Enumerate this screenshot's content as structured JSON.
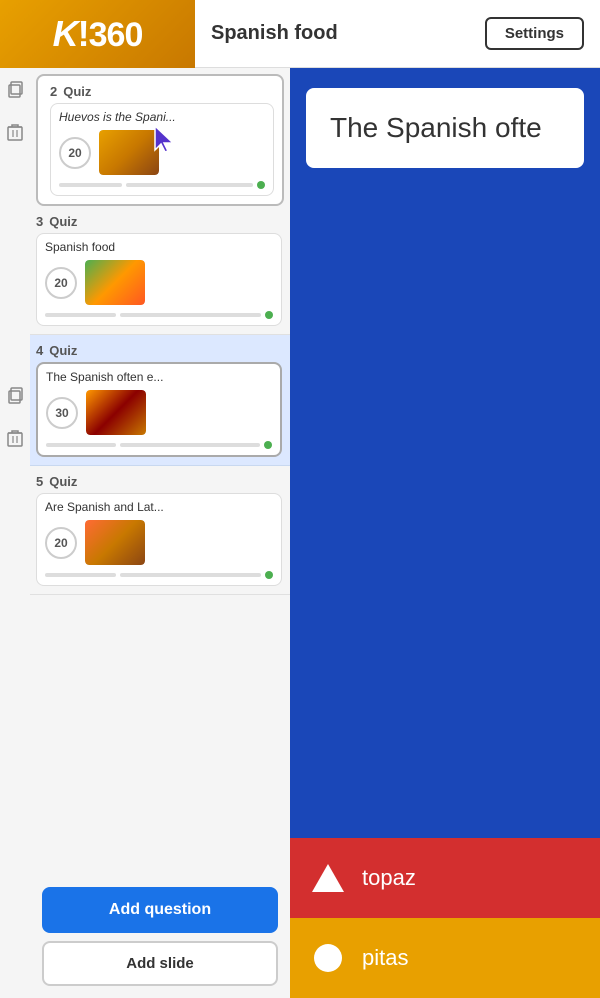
{
  "header": {
    "logo": "K!360",
    "title": "Spanish food",
    "settings_label": "Settings"
  },
  "sidebar": {
    "items": [
      {
        "num": "2",
        "type": "Quiz",
        "title": "Huevos is the Spani...",
        "points": "20",
        "bars": true,
        "dot": true,
        "food_type": "1",
        "state": "selected"
      },
      {
        "num": "3",
        "type": "Quiz",
        "title": "Spanish food",
        "points": "20",
        "bars": true,
        "dot": true,
        "food_type": "2",
        "state": "normal"
      },
      {
        "num": "4",
        "type": "Quiz",
        "title": "The Spanish often e...",
        "points": "30",
        "bars": true,
        "dot": true,
        "food_type": "3",
        "state": "active"
      },
      {
        "num": "5",
        "type": "Quiz",
        "title": "Are Spanish and Lat...",
        "points": "20",
        "bars": true,
        "dot": true,
        "food_type": "4",
        "state": "normal"
      }
    ],
    "add_question_label": "Add question",
    "add_slide_label": "Add slide"
  },
  "content": {
    "question_text": "The Spanish ofte",
    "answers": [
      {
        "shape": "triangle",
        "text": "topaz",
        "color": "red"
      },
      {
        "shape": "circle",
        "text": "pitas",
        "color": "gold"
      }
    ]
  }
}
